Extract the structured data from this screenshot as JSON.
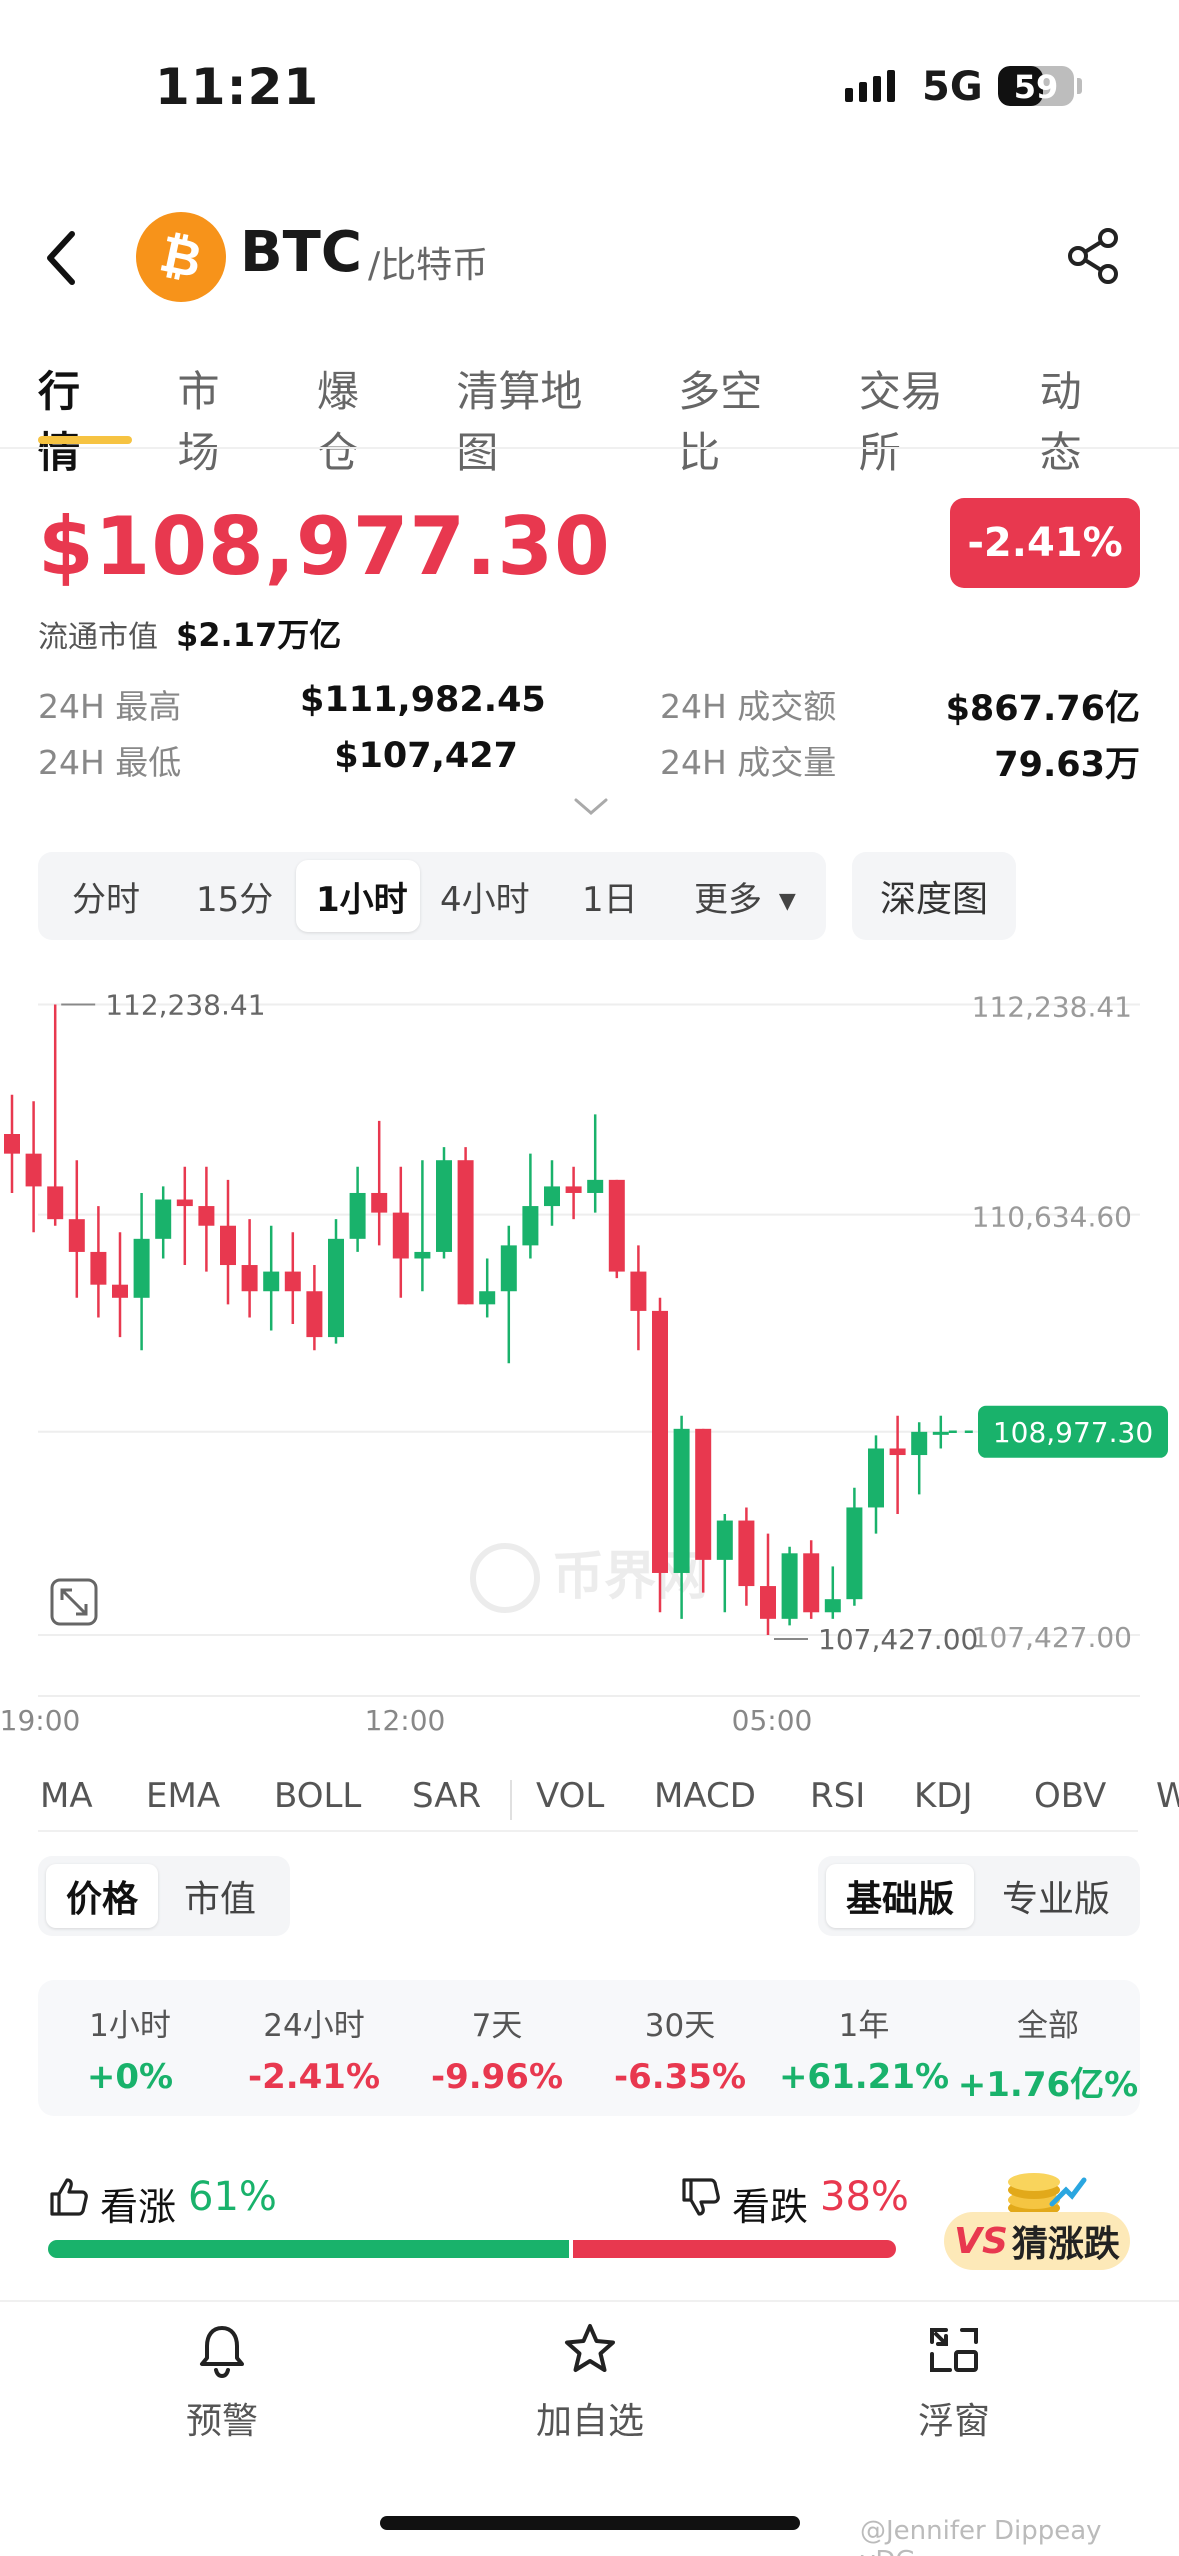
{
  "status_bar": {
    "time": "11:21",
    "network": "5G",
    "battery": "59",
    "battery_level": 0.59
  },
  "header": {
    "coin_symbol": "BTC",
    "coin_subtitle": "/比特币"
  },
  "tabs": [
    "行情",
    "市场",
    "爆仓",
    "清算地图",
    "多空比",
    "交易所",
    "动态"
  ],
  "price": {
    "current": "$108,977.30",
    "change": "-2.41%",
    "market_cap_label": "流通市值",
    "market_cap_value": "$2.17万亿",
    "high_label": "24H 最高",
    "high_value": "$111,982.45",
    "low_label": "24H 最低",
    "low_value": "$107,427",
    "turnover_label": "24H 成交额",
    "turnover_value": "$867.76亿",
    "volume_label": "24H 成交量",
    "volume_value": "79.63万"
  },
  "chart_controls": {
    "periods": [
      "分时",
      "15分",
      "1小时",
      "4小时",
      "1日",
      "更多"
    ],
    "active_period": "1小时",
    "depth": "深度图"
  },
  "chart_data": {
    "type": "candlestick",
    "ylim": [
      106900,
      112700
    ],
    "y_ticks": [
      "112,238.41",
      "110,634.60",
      "107,427.00"
    ],
    "x_ticks": [
      "19:00",
      "12:00",
      "05:00"
    ],
    "high_marker": "112,238.41",
    "low_marker": "107,427.00",
    "current_price": "108,977.30",
    "watermark": "币界网",
    "candles": [
      {
        "o": 111250,
        "h": 111550,
        "c": 111100,
        "l": 110800
      },
      {
        "o": 111100,
        "h": 111500,
        "c": 110850,
        "l": 110500
      },
      {
        "o": 110850,
        "h": 112238,
        "c": 110600,
        "l": 110550
      },
      {
        "o": 110600,
        "h": 111050,
        "c": 110350,
        "l": 110000
      },
      {
        "o": 110350,
        "h": 110700,
        "c": 110100,
        "l": 109850
      },
      {
        "o": 110100,
        "h": 110500,
        "c": 110000,
        "l": 109700
      },
      {
        "o": 110000,
        "h": 110800,
        "c": 110450,
        "l": 109600
      },
      {
        "o": 110450,
        "h": 110850,
        "c": 110750,
        "l": 110300
      },
      {
        "o": 110750,
        "h": 111000,
        "c": 110700,
        "l": 110250
      },
      {
        "o": 110700,
        "h": 111000,
        "c": 110550,
        "l": 110200
      },
      {
        "o": 110550,
        "h": 110900,
        "c": 110250,
        "l": 109950
      },
      {
        "o": 110250,
        "h": 110600,
        "c": 110050,
        "l": 109850
      },
      {
        "o": 110050,
        "h": 110550,
        "c": 110200,
        "l": 109750
      },
      {
        "o": 110200,
        "h": 110500,
        "c": 110050,
        "l": 109800
      },
      {
        "o": 110050,
        "h": 110250,
        "c": 109700,
        "l": 109600
      },
      {
        "o": 109700,
        "h": 110600,
        "c": 110450,
        "l": 109650
      },
      {
        "o": 110450,
        "h": 111000,
        "c": 110800,
        "l": 110350
      },
      {
        "o": 110800,
        "h": 111350,
        "c": 110650,
        "l": 110400
      },
      {
        "o": 110650,
        "h": 111000,
        "c": 110300,
        "l": 110000
      },
      {
        "o": 110300,
        "h": 111050,
        "c": 110350,
        "l": 110050
      },
      {
        "o": 110350,
        "h": 111150,
        "c": 111050,
        "l": 110300
      },
      {
        "o": 111050,
        "h": 111150,
        "c": 109950,
        "l": 109950
      },
      {
        "o": 109950,
        "h": 110300,
        "c": 110050,
        "l": 109850
      },
      {
        "o": 110050,
        "h": 110550,
        "c": 110400,
        "l": 109500
      },
      {
        "o": 110400,
        "h": 111100,
        "c": 110700,
        "l": 110300
      },
      {
        "o": 110700,
        "h": 111050,
        "c": 110850,
        "l": 110550
      },
      {
        "o": 110850,
        "h": 111000,
        "c": 110800,
        "l": 110600
      },
      {
        "o": 110800,
        "h": 111400,
        "c": 110900,
        "l": 110650
      },
      {
        "o": 110900,
        "h": 110900,
        "c": 110200,
        "l": 110150
      },
      {
        "o": 110200,
        "h": 110400,
        "c": 109900,
        "l": 109600
      },
      {
        "o": 109900,
        "h": 110000,
        "c": 107900,
        "l": 107600
      },
      {
        "o": 107900,
        "h": 109100,
        "c": 109000,
        "l": 107550
      },
      {
        "o": 109000,
        "h": 109000,
        "c": 108000,
        "l": 107750
      },
      {
        "o": 108000,
        "h": 108350,
        "c": 108300,
        "l": 107600
      },
      {
        "o": 108300,
        "h": 108400,
        "c": 107800,
        "l": 107650
      },
      {
        "o": 107800,
        "h": 108200,
        "c": 107550,
        "l": 107427
      },
      {
        "o": 107550,
        "h": 108100,
        "c": 108050,
        "l": 107500
      },
      {
        "o": 108050,
        "h": 108150,
        "c": 107600,
        "l": 107550
      },
      {
        "o": 107600,
        "h": 107950,
        "c": 107700,
        "l": 107550
      },
      {
        "o": 107700,
        "h": 108550,
        "c": 108400,
        "l": 107650
      },
      {
        "o": 108400,
        "h": 108950,
        "c": 108850,
        "l": 108200
      },
      {
        "o": 108850,
        "h": 109100,
        "c": 108800,
        "l": 108350
      },
      {
        "o": 108800,
        "h": 109050,
        "c": 108977,
        "l": 108500
      },
      {
        "o": 108977,
        "h": 109100,
        "c": 108977,
        "l": 108850
      }
    ]
  },
  "indicators": [
    "MA",
    "EMA",
    "BOLL",
    "SAR",
    "VOL",
    "MACD",
    "RSI",
    "KDJ",
    "OBV",
    "W"
  ],
  "toggle_left": {
    "options": [
      "价格",
      "市值"
    ],
    "selected": "价格"
  },
  "toggle_right": {
    "options": [
      "基础版",
      "专业版"
    ],
    "selected": "基础版"
  },
  "performance": [
    {
      "label": "1小时",
      "value": "+0%",
      "dir": "up"
    },
    {
      "label": "24小时",
      "value": "-2.41%",
      "dir": "down"
    },
    {
      "label": "7天",
      "value": "-9.96%",
      "dir": "down"
    },
    {
      "label": "30天",
      "value": "-6.35%",
      "dir": "down"
    },
    {
      "label": "1年",
      "value": "+61.21%",
      "dir": "up"
    },
    {
      "label": "全部",
      "value": "+1.76亿%",
      "dir": "up"
    }
  ],
  "sentiment": {
    "bull_label": "看涨",
    "bull_pct": "61%",
    "bull_share": 0.61,
    "bear_label": "看跌",
    "bear_pct": "38%",
    "bear_share": 0.38,
    "guess_vs": "VS",
    "guess_label": "猜涨跌"
  },
  "bottom_nav": [
    {
      "label": "预警",
      "icon": "bell-icon"
    },
    {
      "label": "加自选",
      "icon": "star-icon"
    },
    {
      "label": "浮窗",
      "icon": "float-window-icon"
    }
  ],
  "watermark_text": "@Jennifer Dippeay yDG...",
  "colors": {
    "up": "#19b26b",
    "down": "#e8384f",
    "accent": "#f6c342",
    "bitcoin": "#f7931a"
  }
}
